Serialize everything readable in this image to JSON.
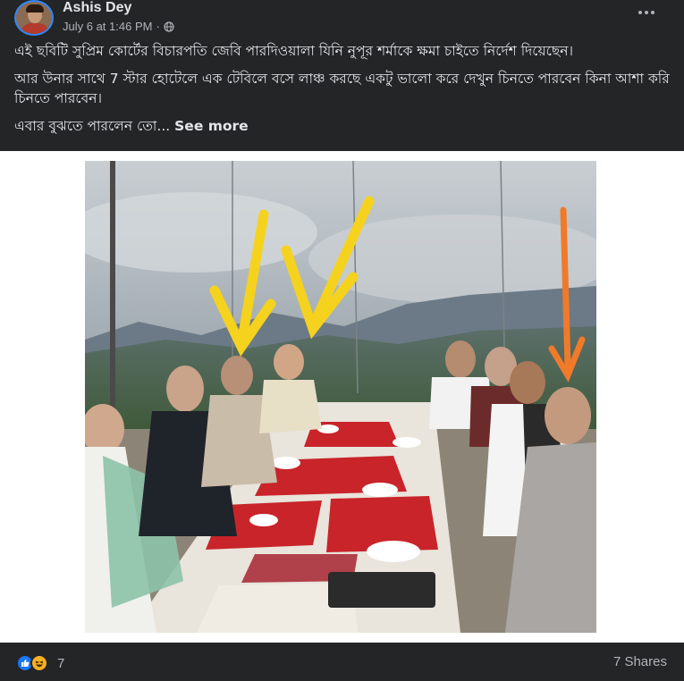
{
  "post": {
    "author": "Ashis Dey",
    "timestamp": "July 6 at 1:46 PM",
    "separator": "·",
    "privacy_icon": "globe-icon",
    "menu_icon": "more-horizontal-icon",
    "text_lines": [
      "এই ছবিটি সুপ্রিম কোর্টের বিচারপতি জেবি  পারদিওয়ালা যিনি নুপূর শর্মাকে ক্ষমা চাইতে নির্দেশ দিয়েছেন।",
      "আর উনার সাথে 7 স্টার হোটেলে এক টেবিলে বসে লাঞ্চ করছে একটু ভালো করে দেখুন চিনতে পারবেন কিনা আশা করি চিনতে পারবেন।",
      "এবার বুঝতে পারলেন তো..."
    ],
    "see_more": "See more",
    "photo": {
      "description_icon": "group-lunch-photo",
      "arrow_colors": {
        "yellow": "#f5d21e",
        "orange": "#f07a2a"
      }
    }
  },
  "footer": {
    "reactions": [
      "like-icon",
      "haha-icon"
    ],
    "reaction_count": "7",
    "shares": "7 Shares"
  },
  "colors": {
    "background": "#242526",
    "text_primary": "#e4e6eb",
    "text_secondary": "#b0b3b8",
    "accent": "#1877f2"
  }
}
